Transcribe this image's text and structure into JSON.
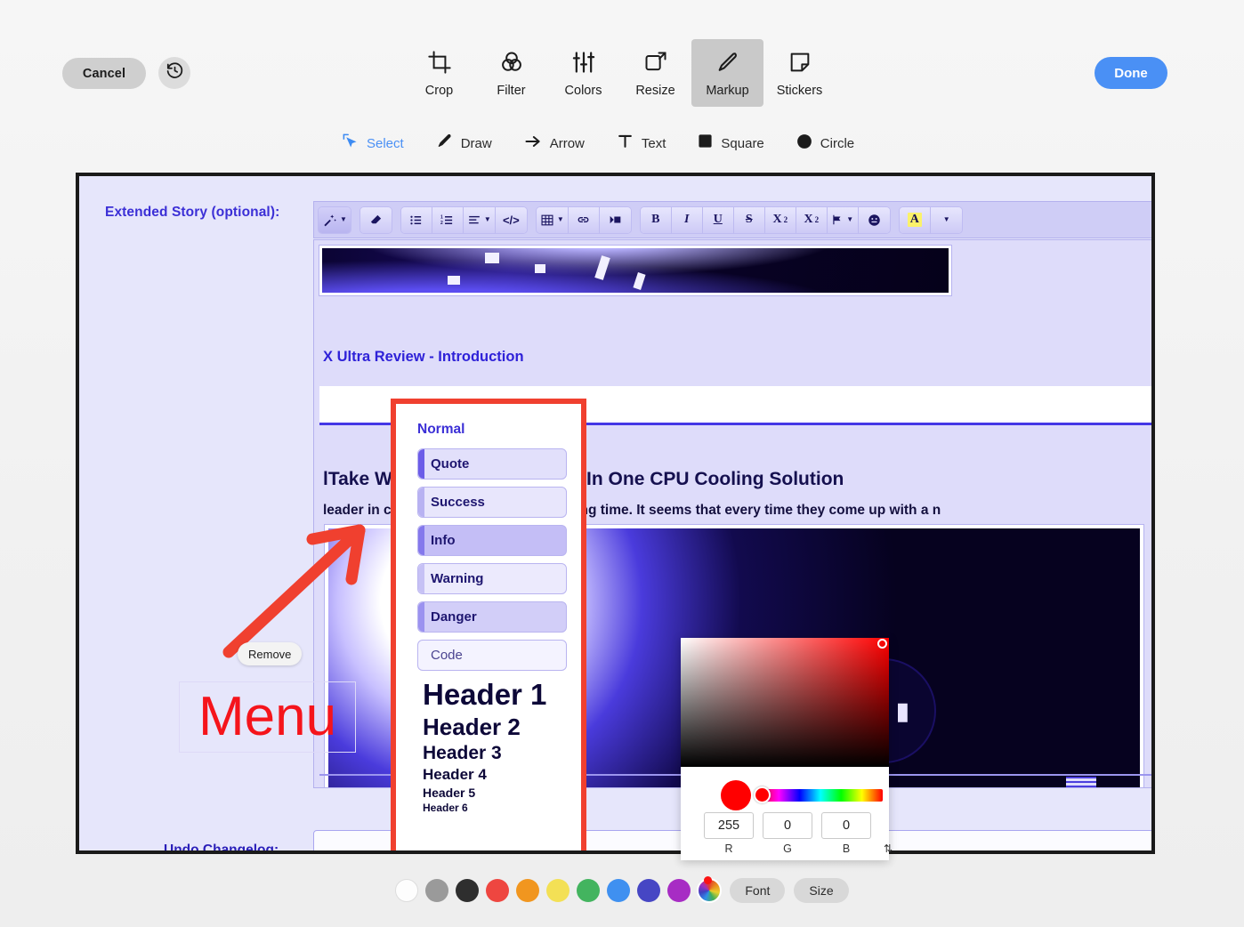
{
  "topbar": {
    "cancel_label": "Cancel",
    "history_icon": "history-revert-icon",
    "done_label": "Done",
    "tools": [
      {
        "label": "Crop",
        "icon": "crop-icon",
        "active": false
      },
      {
        "label": "Filter",
        "icon": "filter-icon",
        "active": false
      },
      {
        "label": "Colors",
        "icon": "sliders-icon",
        "active": false
      },
      {
        "label": "Resize",
        "icon": "resize-icon",
        "active": false
      },
      {
        "label": "Markup",
        "icon": "pencil-icon",
        "active": true
      },
      {
        "label": "Stickers",
        "icon": "sticker-icon",
        "active": false
      }
    ],
    "markup_tools": [
      {
        "label": "Select",
        "icon": "cursor-select-icon",
        "active": true
      },
      {
        "label": "Draw",
        "icon": "pencil-icon",
        "active": false
      },
      {
        "label": "Arrow",
        "icon": "arrow-icon",
        "active": false
      },
      {
        "label": "Text",
        "icon": "text-t-icon",
        "active": false
      },
      {
        "label": "Square",
        "icon": "square-icon",
        "active": false
      },
      {
        "label": "Circle",
        "icon": "circle-icon",
        "active": false
      }
    ]
  },
  "canvas": {
    "form_label": "Extended Story (optional):",
    "undo_label": "Undo Changelog:",
    "editor_toolbar": {
      "groups": [
        {
          "buttons": [
            {
              "name": "style-magic-wand",
              "glyph": "✨",
              "caret": true,
              "selected": true
            }
          ]
        },
        {
          "buttons": [
            {
              "name": "eraser-format",
              "glyph": "▰",
              "caret": false,
              "selected": false
            }
          ]
        },
        {
          "buttons": [
            {
              "name": "unordered-list",
              "glyph": "☰",
              "caret": false,
              "selected": false
            },
            {
              "name": "ordered-list",
              "glyph": "≣",
              "caret": false,
              "selected": false
            },
            {
              "name": "align",
              "glyph": "≡",
              "caret": true,
              "selected": false
            },
            {
              "name": "code-block",
              "glyph": "</>",
              "caret": false,
              "selected": false
            }
          ]
        },
        {
          "buttons": [
            {
              "name": "table",
              "glyph": "▦",
              "caret": true,
              "selected": false
            },
            {
              "name": "link",
              "glyph": "⚭",
              "caret": false,
              "selected": false
            },
            {
              "name": "media",
              "glyph": "▶▪",
              "caret": false,
              "selected": false
            }
          ]
        },
        {
          "buttons": [
            {
              "name": "bold",
              "glyph": "B",
              "caret": false,
              "selected": false
            },
            {
              "name": "italic",
              "glyph": "I",
              "caret": false,
              "selected": false
            },
            {
              "name": "underline",
              "glyph": "U",
              "caret": false,
              "selected": false
            },
            {
              "name": "strikethrough",
              "glyph": "S",
              "caret": false,
              "selected": false
            },
            {
              "name": "superscript",
              "glyph": "X²",
              "caret": false,
              "selected": false
            },
            {
              "name": "subscript",
              "glyph": "X₂",
              "caret": false,
              "selected": false
            },
            {
              "name": "flag",
              "glyph": "⚑",
              "caret": true,
              "selected": false
            },
            {
              "name": "emoji",
              "glyph": "☺",
              "caret": false,
              "selected": false
            }
          ]
        },
        {
          "buttons": [
            {
              "name": "text-highlight-color",
              "glyph": "A",
              "caret": false,
              "selected": false,
              "highlight": true
            },
            {
              "name": "color-dropdown",
              "glyph": "",
              "caret": true,
              "selected": false
            }
          ]
        }
      ]
    },
    "article": {
      "heading_small": "X Ultra Review - Introduction",
      "heading_large": "lTake Water 3.0 240 ARGB All In One CPU Cooling Solution",
      "paragraph": "leader in cooling solutions for a very long time. It seems that every time they come up with a n"
    }
  },
  "dropdown": {
    "title": "Normal",
    "items": [
      {
        "label": "Quote",
        "bar": "#6b5ce8",
        "fill": "#e2e0fb"
      },
      {
        "label": "Success",
        "bar": "#b8b2f2",
        "fill": "#e8e6fc"
      },
      {
        "label": "Info",
        "bar": "#8478ec",
        "fill": "#c4bef6"
      },
      {
        "label": "Warning",
        "bar": "#c6c1f5",
        "fill": "#eceafd"
      },
      {
        "label": "Danger",
        "bar": "#9b92f0",
        "fill": "#d2cef8"
      },
      {
        "label": "Code",
        "bar": "#f0eefe",
        "fill": "#f4f3ff"
      }
    ],
    "headers": [
      "Header 1",
      "Header 2",
      "Header 3",
      "Header 4",
      "Header 5",
      "Header 6"
    ]
  },
  "annotations": {
    "remove_tooltip": "Remove",
    "text_annotation": "Menu",
    "arrow_color": "#f0402f",
    "text_color": "#f5141b",
    "selection_color": "#f0402f"
  },
  "color_picker": {
    "r_value": "255",
    "g_value": "0",
    "b_value": "0",
    "r_label": "R",
    "g_label": "G",
    "b_label": "B",
    "spinner_icon": "stepper-updown-icon",
    "selected_color": "#ff0000"
  },
  "bottom_bar": {
    "swatches": [
      {
        "name": "white",
        "color": "#fdfdfd"
      },
      {
        "name": "gray",
        "color": "#9a9a9a"
      },
      {
        "name": "black",
        "color": "#2e2e2e"
      },
      {
        "name": "red",
        "color": "#ee4640"
      },
      {
        "name": "orange",
        "color": "#f1961f"
      },
      {
        "name": "yellow",
        "color": "#f3e055"
      },
      {
        "name": "green",
        "color": "#43b45f"
      },
      {
        "name": "blue",
        "color": "#3f90f0"
      },
      {
        "name": "indigo",
        "color": "#4646c4"
      },
      {
        "name": "purple",
        "color": "#a72cc4"
      }
    ],
    "rainbow_name": "custom-color-wheel",
    "font_label": "Font",
    "size_label": "Size"
  }
}
